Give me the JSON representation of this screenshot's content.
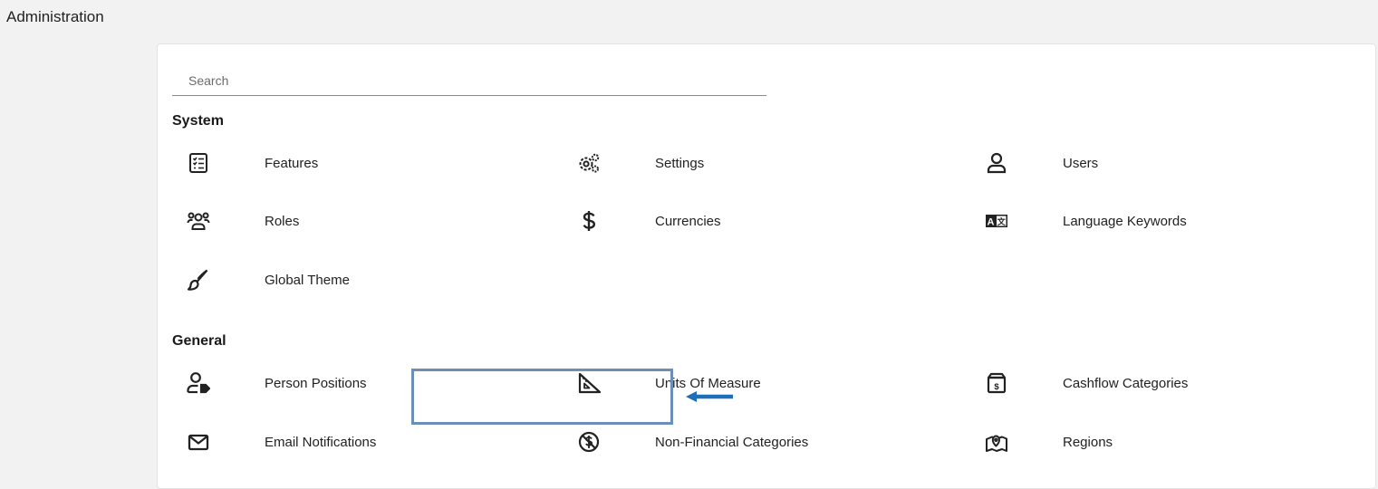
{
  "page": {
    "title": "Administration"
  },
  "search": {
    "placeholder": "Search",
    "value": ""
  },
  "sections": {
    "system": {
      "title": "System",
      "items": {
        "features": {
          "label": "Features",
          "icon": "checklist-icon"
        },
        "settings": {
          "label": "Settings",
          "icon": "gears-icon"
        },
        "users": {
          "label": "Users",
          "icon": "user-icon"
        },
        "roles": {
          "label": "Roles",
          "icon": "users-group-icon"
        },
        "currencies": {
          "label": "Currencies",
          "icon": "dollar-icon"
        },
        "language_keywords": {
          "label": "Language Keywords",
          "icon": "language-icon"
        },
        "global_theme": {
          "label": "Global Theme",
          "icon": "brush-icon"
        }
      }
    },
    "general": {
      "title": "General",
      "items": {
        "person_positions": {
          "label": "Person Positions",
          "icon": "user-tag-icon"
        },
        "units_of_measure": {
          "label": "Units Of Measure",
          "icon": "ruler-triangle-icon"
        },
        "cashflow_categories": {
          "label": "Cashflow Categories",
          "icon": "money-box-icon"
        },
        "email_notifications": {
          "label": "Email Notifications",
          "icon": "envelope-icon"
        },
        "non_financial_categories": {
          "label": "Non-Financial Categories",
          "icon": "no-dollar-icon"
        },
        "regions": {
          "label": "Regions",
          "icon": "map-pin-icon"
        }
      }
    }
  },
  "annotation": {
    "highlight_color": "#6b8fb6",
    "arrow_color": "#1f6fb8"
  }
}
